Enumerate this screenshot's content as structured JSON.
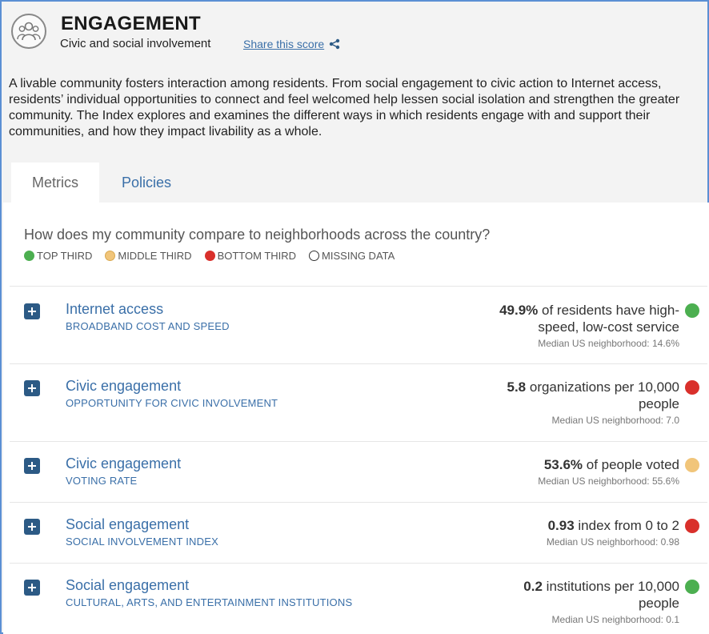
{
  "header": {
    "title": "ENGAGEMENT",
    "subtitle": "Civic and social involvement",
    "share_label": "Share this score",
    "icon": "people-group-icon"
  },
  "intro": "A livable community fosters interaction among residents. From social engagement to civic action to Internet access, residents’ individual opportunities to connect and feel welcomed help lessen social isolation and strengthen the greater community. The Index explores and examines the different ways in which residents engage with and support their communities, and how they impact livability as a whole.",
  "tabs": [
    {
      "label": "Metrics",
      "active": true
    },
    {
      "label": "Policies",
      "active": false
    }
  ],
  "question": "How does my community compare to neighborhoods across the country?",
  "legend": [
    {
      "label": "TOP THIRD",
      "color": "#4caf50"
    },
    {
      "label": "MIDDLE THIRD",
      "color": "#f1c57a"
    },
    {
      "label": "BOTTOM THIRD",
      "color": "#d9302b"
    },
    {
      "label": "MISSING DATA",
      "color": "#ffffff"
    }
  ],
  "metrics": [
    {
      "title": "Internet access",
      "subtitle": "BROADBAND COST AND SPEED",
      "value": "49.9%",
      "value_text": " of residents have high-speed, low-cost service",
      "median": "Median US neighborhood: 14.6%",
      "status": "top",
      "color": "#4caf50"
    },
    {
      "title": "Civic engagement",
      "subtitle": "OPPORTUNITY FOR CIVIC INVOLVEMENT",
      "value": "5.8",
      "value_text": " organizations per 10,000 people",
      "median": "Median US neighborhood: 7.0",
      "status": "bottom",
      "color": "#d9302b"
    },
    {
      "title": "Civic engagement",
      "subtitle": "VOTING RATE",
      "value": "53.6%",
      "value_text": " of people voted",
      "median": "Median US neighborhood: 55.6%",
      "status": "middle",
      "color": "#f1c57a"
    },
    {
      "title": "Social engagement",
      "subtitle": "SOCIAL INVOLVEMENT INDEX",
      "value": "0.93",
      "value_text": " index from 0 to 2",
      "median": "Median US neighborhood: 0.98",
      "status": "bottom",
      "color": "#d9302b"
    },
    {
      "title": "Social engagement",
      "subtitle": "CULTURAL, ARTS, AND ENTERTAINMENT INSTITUTIONS",
      "value": "0.2",
      "value_text": " institutions per 10,000 people",
      "median": "Median US neighborhood: 0.1",
      "status": "top",
      "color": "#4caf50"
    }
  ]
}
